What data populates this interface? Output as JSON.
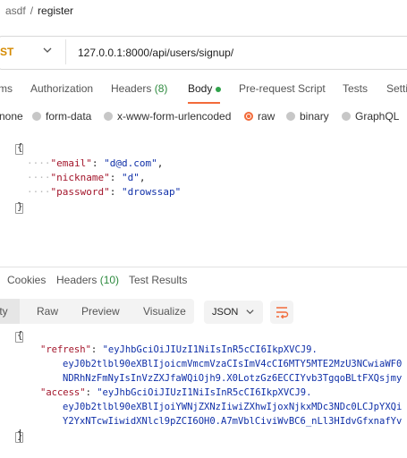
{
  "breadcrumb": {
    "parent": "asdf",
    "separator": "/",
    "current": "register"
  },
  "request": {
    "method": "ST",
    "url": "127.0.0.1:8000/api/users/signup/"
  },
  "request_tabs": [
    {
      "label": "ms"
    },
    {
      "label": "Authorization"
    },
    {
      "label": "Headers",
      "count": "(8)"
    },
    {
      "label": "Body"
    },
    {
      "label": "Pre-request Script"
    },
    {
      "label": "Tests"
    },
    {
      "label": "Setti"
    }
  ],
  "body_types": [
    "none",
    "form-data",
    "x-www-form-urlencoded",
    "raw",
    "binary",
    "GraphQL"
  ],
  "body_selected": "raw",
  "request_body": {
    "open": "{",
    "close": "}",
    "lines": [
      {
        "dots": "····",
        "key": "\"email\"",
        "sep": ": ",
        "value": "\"d@d.com\"",
        "tail": ","
      },
      {
        "dots": "····",
        "key": "\"nickname\"",
        "sep": ": ",
        "value": "\"d\"",
        "tail": ","
      },
      {
        "dots": "····",
        "key": "\"password\"",
        "sep": ": ",
        "value": "\"drowssap\"",
        "tail": ""
      }
    ]
  },
  "response_tabs": [
    {
      "label": "Cookies"
    },
    {
      "label": "Headers",
      "count": "(10)"
    },
    {
      "label": "Test Results"
    }
  ],
  "view_modes": [
    "tty",
    "Raw",
    "Preview",
    "Visualize"
  ],
  "format": "JSON",
  "response_body": {
    "open": "{",
    "close": "}",
    "refresh_key": "\"refresh\"",
    "refresh_val_1": "\"eyJhbGciOiJIUzI1NiIsInR5cCI6IkpXVCJ9.",
    "refresh_val_2": "eyJ0b2tlbl90eXBlIjoicmVmcmVzaCIsImV4cCI6MTY5MTE2MzU3NCwiaWF0",
    "refresh_val_3": "NDRhNzFmNyIsInVzZXJfaWQiOjh9.X0LotzGz6ECCIYvb3TgqoBLtFXQsjmy",
    "access_key": "\"access\"",
    "access_val_1": "\"eyJhbGciOiJIUzI1NiIsInR5cCI6IkpXVCJ9.",
    "access_val_2": "eyJ0b2tlbl90eXBlIjoiYWNjZXNzIiwiZXhwIjoxNjkxMDc3NDc0LCJpYXQi",
    "access_val_3": "Y2YxNTcwIiwidXNlcl9pZCI6OH0.A7mVblCiviWvBC6_nLl3HIdvGfxnafYv"
  }
}
